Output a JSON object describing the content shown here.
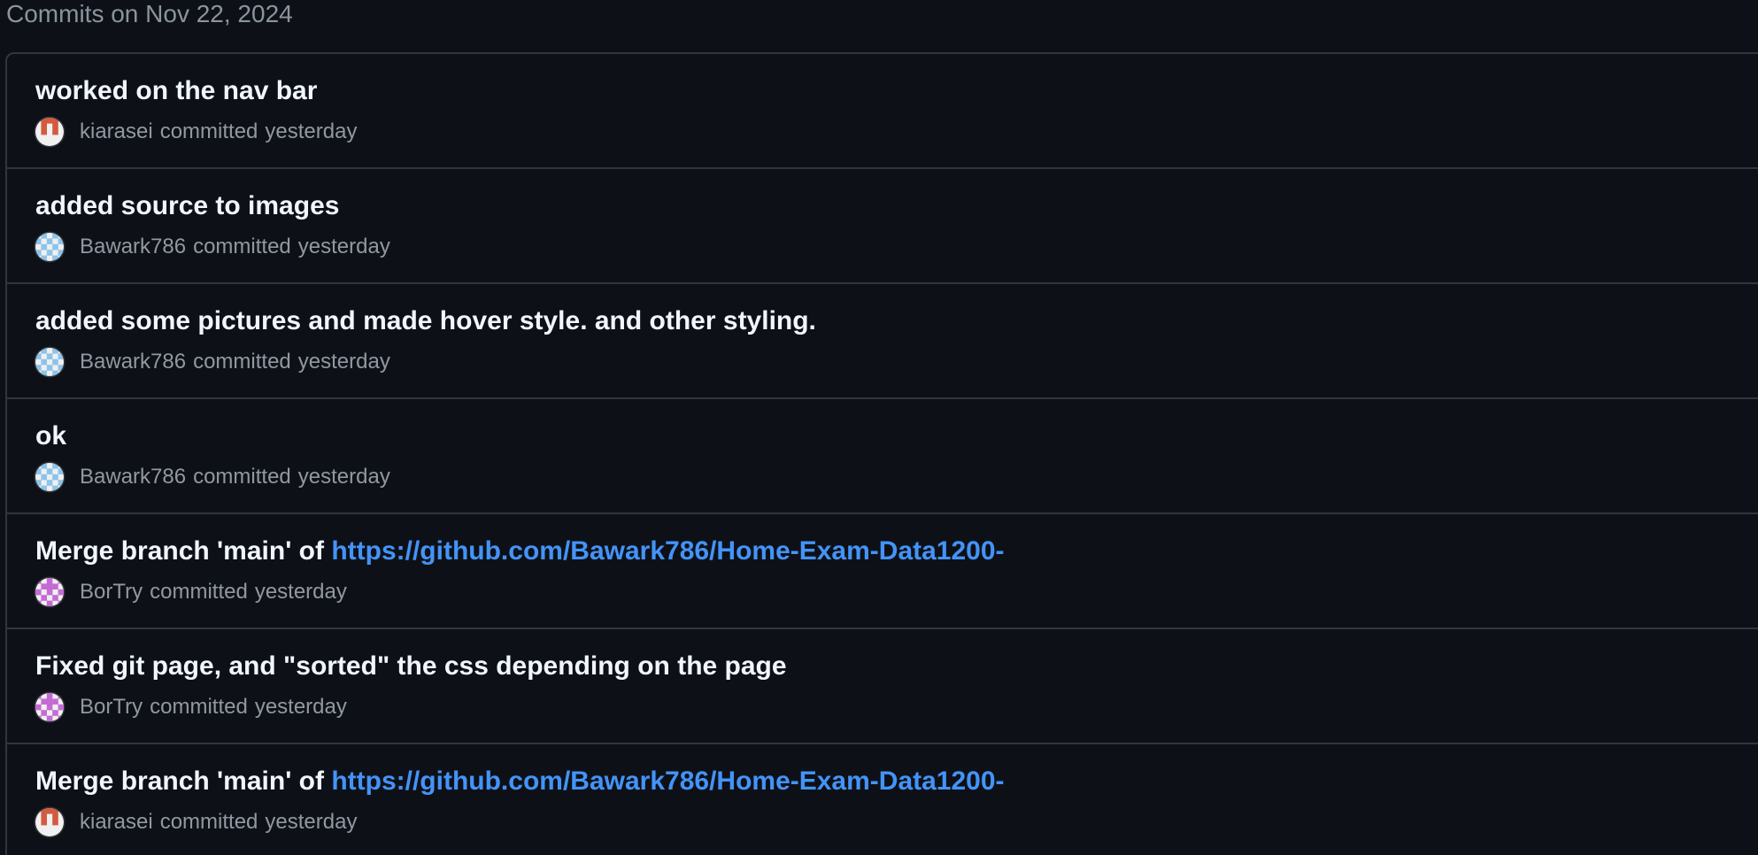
{
  "group": {
    "heading": "Commits on Nov 22, 2024"
  },
  "commits": [
    {
      "message": "worked on the nav bar",
      "link": "",
      "author": "kiarasei",
      "action": "committed",
      "time": "yesterday",
      "avatar_icon": "identicon-kiarasei",
      "avatar_color": "#d45a3f"
    },
    {
      "message": "added source to images",
      "link": "",
      "author": "Bawark786",
      "action": "committed",
      "time": "yesterday",
      "avatar_icon": "identicon-bawark786",
      "avatar_color": "#8cc3ea"
    },
    {
      "message": "added some pictures and made hover style. and other styling.",
      "link": "",
      "author": "Bawark786",
      "action": "committed",
      "time": "yesterday",
      "avatar_icon": "identicon-bawark786",
      "avatar_color": "#8cc3ea"
    },
    {
      "message": "ok",
      "link": "",
      "author": "Bawark786",
      "action": "committed",
      "time": "yesterday",
      "avatar_icon": "identicon-bawark786",
      "avatar_color": "#8cc3ea"
    },
    {
      "message": "Merge branch 'main' of ",
      "link": "https://github.com/Bawark786/Home-Exam-Data1200-",
      "author": "BorTry",
      "action": "committed",
      "time": "yesterday",
      "avatar_icon": "identicon-bortry",
      "avatar_color": "#c56ad4"
    },
    {
      "message": "Fixed git page, and \"sorted\" the css depending on the page",
      "link": "",
      "author": "BorTry",
      "action": "committed",
      "time": "yesterday",
      "avatar_icon": "identicon-bortry",
      "avatar_color": "#c56ad4"
    },
    {
      "message": "Merge branch 'main' of ",
      "link": "https://github.com/Bawark786/Home-Exam-Data1200-",
      "author": "kiarasei",
      "action": "committed",
      "time": "yesterday",
      "avatar_icon": "identicon-kiarasei",
      "avatar_color": "#d45a3f"
    }
  ],
  "colors": {
    "background": "#0d1117",
    "border": "#30363d",
    "title_text": "#f0f6fc",
    "muted_text": "#9198a1",
    "link": "#4493f8"
  }
}
